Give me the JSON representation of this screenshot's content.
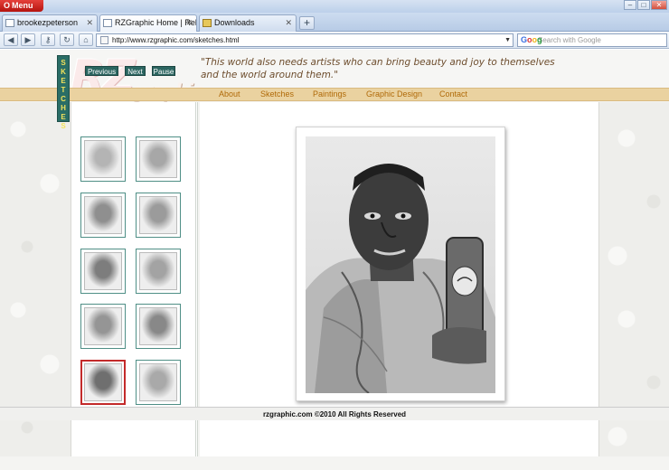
{
  "browser": {
    "menu_label": "Menu",
    "tabs": [
      {
        "title": "brookezpeterson"
      },
      {
        "title": "RZGraphic Home | Reb..."
      },
      {
        "title": "Downloads"
      }
    ],
    "address": "http://www.rzgraphic.com/sketches.html",
    "search_placeholder": "Search with Google"
  },
  "site": {
    "logo_main": "RZ",
    "logo_sub": "graphic",
    "tagline": "\"This world also needs artists who can bring beauty and joy to themselves and the world around them.\"",
    "nav": [
      "About",
      "Sketches",
      "Paintings",
      "Graphic Design",
      "Contact"
    ],
    "section_tab": "SKETCHES",
    "controls": {
      "previous": "Previous",
      "next": "Next",
      "pause": "Pause"
    },
    "selected_thumbnail": 8,
    "thumbnail_count": 10,
    "footer": "rzgraphic.com ©2010 All Rights Reserved"
  },
  "icons": {
    "back": "left-arrow-icon",
    "forward": "right-arrow-icon",
    "key": "key-icon",
    "reload": "reload-icon",
    "home": "home-icon"
  },
  "colors": {
    "nav_bar": "#ead2a0",
    "nav_text": "#b06a08",
    "button_bg": "#2b6560",
    "selected_border": "#c32a2a"
  }
}
